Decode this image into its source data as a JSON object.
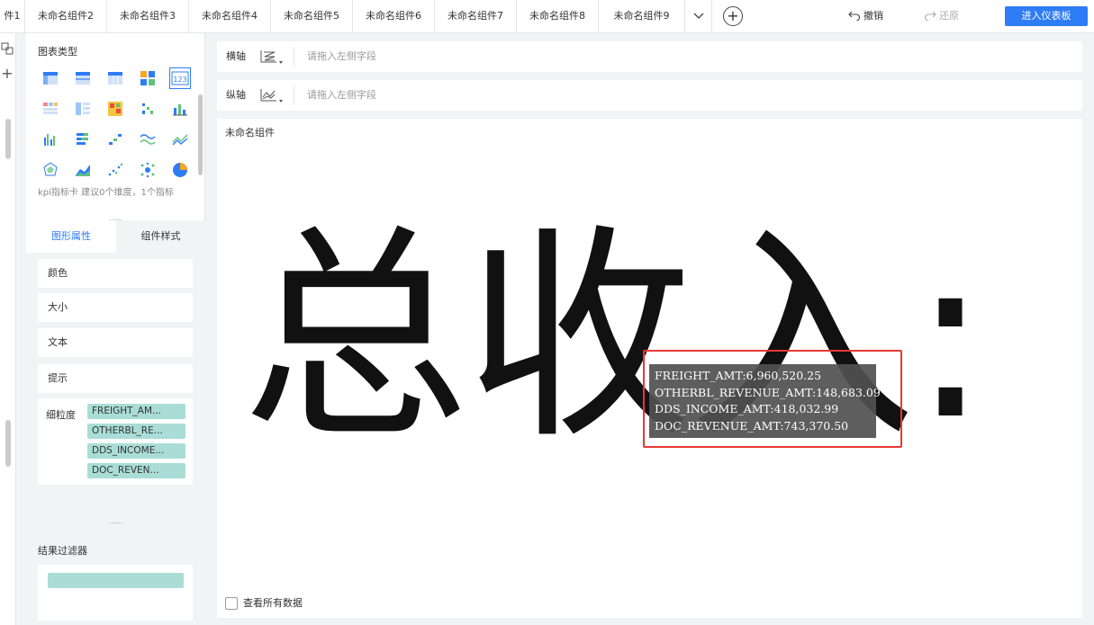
{
  "tabs": [
    "件1",
    "未命名组件2",
    "未命名组件3",
    "未命名组件4",
    "未命名组件5",
    "未命名组件6",
    "未命名组件7",
    "未命名组件8",
    "未命名组件9"
  ],
  "toolbar": {
    "undo_label": "撤销",
    "redo_label": "还原",
    "enter_dashboard_label": "进入仪表板",
    "add_icon": "plus-circle-icon",
    "more_icon": "chevron-down-icon"
  },
  "chart_types": {
    "title": "图表类型",
    "hint": "kpi指标卡 建议0个维度，1个指标"
  },
  "attr_tabs": {
    "graph_props": "图形属性",
    "component_style": "组件样式"
  },
  "properties": {
    "color": "颜色",
    "size": "大小",
    "text": "文本",
    "tooltip": "提示"
  },
  "granularity": {
    "label": "细粒度",
    "fields": [
      "FREIGHT_AM...",
      "OTHERBL_RE...",
      "DDS_INCOME...",
      "DOC_REVEN..."
    ]
  },
  "result_filter": {
    "title": "结果过滤器"
  },
  "x_axis": {
    "label": "横轴",
    "placeholder": "请拖入左侧字段"
  },
  "y_axis": {
    "label": "纵轴",
    "placeholder": "请拖入左侧字段"
  },
  "canvas": {
    "component_title": "未命名组件",
    "kpi_text": "总收入:",
    "view_all_label": "查看所有数据"
  },
  "tooltip_lines": [
    "FREIGHT_AMT:6,960,520.25",
    "OTHERBL_REVENUE_AMT:148,683.09",
    "DDS_INCOME_AMT:418,032.99",
    "DOC_REVENUE_AMT:743,370.50"
  ],
  "colors": {
    "accent": "#2e7cf6",
    "pill": "#a9ddd6",
    "highlight": "#e53935"
  }
}
